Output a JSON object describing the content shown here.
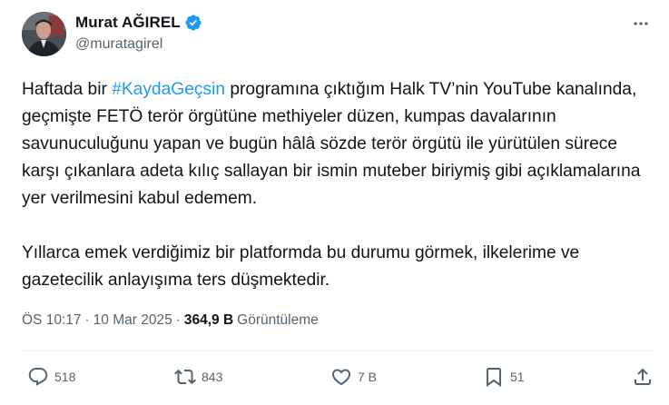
{
  "author": {
    "display_name": "Murat AĞIREL",
    "handle": "@muratagirel",
    "verified": true
  },
  "tweet": {
    "line1_pre": "Haftada bir ",
    "hashtag": "#KaydaGeçsin",
    "line1_post": " programına çıktığım Halk TV’nin YouTube kanalında, geçmişte FETÖ terör örgütüne methiyeler düzen, kumpas davalarının savunuculuğunu yapan ve bugün hâlâ sözde terör örgütü ile yürütülen sürece karşı çıkanlara adeta kılıç sallayan bir ismin muteber biriymiş gibi açıklamalarına yer verilmesini kabul edemem.",
    "paragraph2": "Yıllarca emek verdiğimiz bir platformda bu durumu görmek, ilkelerime ve gazetecilik anlayışıma ters düşmektedir."
  },
  "meta": {
    "time": "ÖS 10:17",
    "separator": "·",
    "date": "10 Mar 2025",
    "views_count": "364,9 B",
    "views_label": "Görüntüleme"
  },
  "actions": {
    "replies": "518",
    "reposts": "843",
    "likes": "7 B",
    "bookmarks": "51"
  },
  "colors": {
    "text": "#0f1419",
    "secondary": "#536471",
    "accent": "#1d9bf0",
    "divider": "#eff3f4"
  },
  "icons": {
    "verified": "verified-badge-icon",
    "more": "more-horizontal-icon",
    "reply": "reply-bubble-icon",
    "repost": "repost-arrows-icon",
    "like": "heart-icon",
    "bookmark": "bookmark-icon",
    "share": "share-upload-icon"
  }
}
